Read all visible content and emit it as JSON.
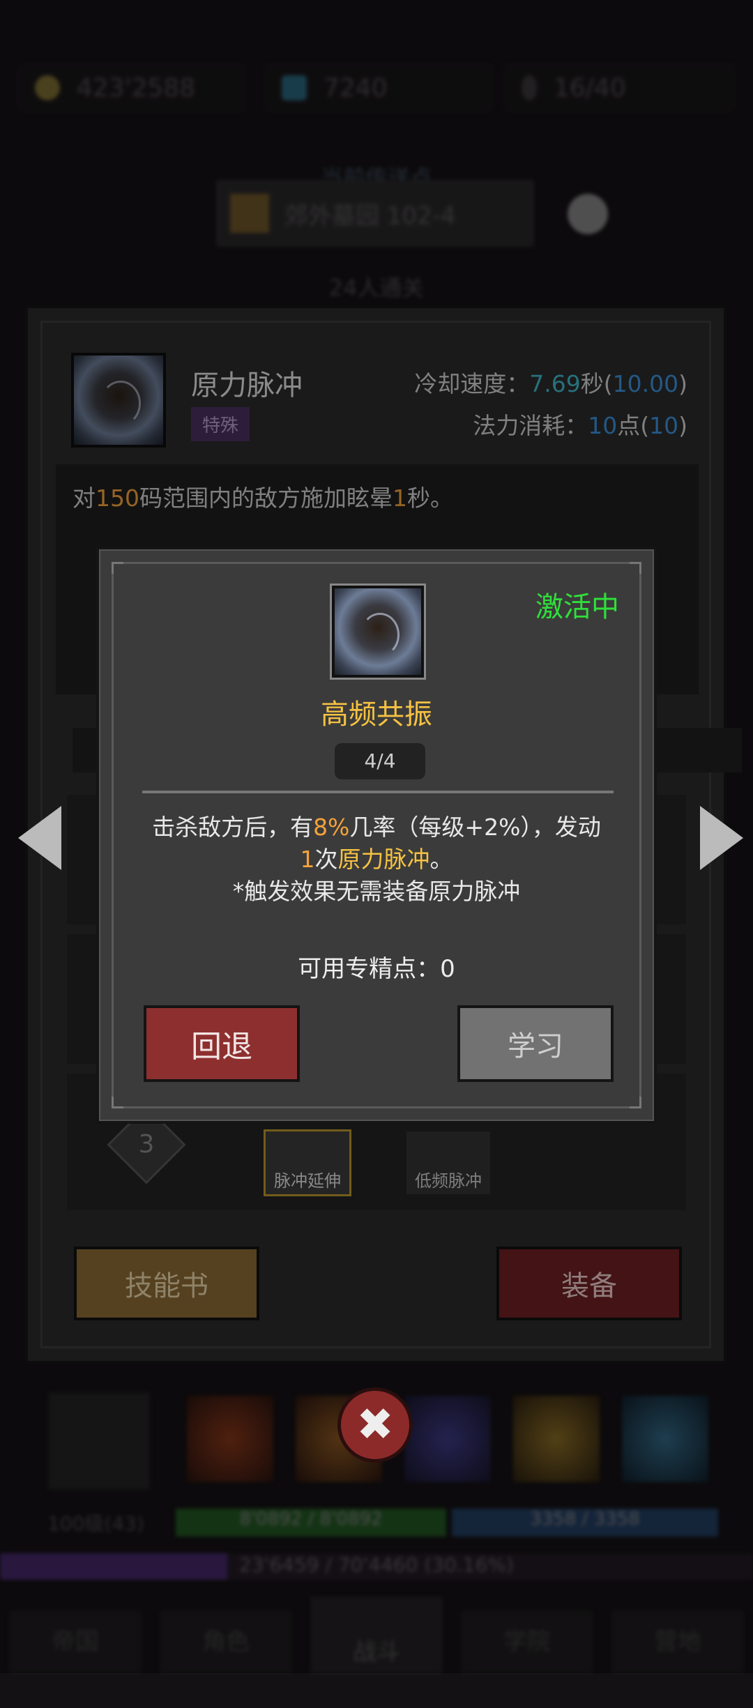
{
  "top_bar": {
    "gold": "423'2588",
    "gems": "7240",
    "keys": "16/40"
  },
  "teleport": {
    "label": "当前传送点",
    "location": "郊外墓园 102-4",
    "clear_text": "24人通关"
  },
  "skill": {
    "name": "原力脉冲",
    "tag": "特殊",
    "cooldown_label": "冷却速度：",
    "cooldown_value": "7.69",
    "cooldown_unit": "秒",
    "cooldown_base": "10.00",
    "mana_label": "法力消耗：",
    "mana_value": "10",
    "mana_unit": "点",
    "mana_base": "10",
    "desc_part1": "对",
    "desc_range": "150",
    "desc_part2": "码范围内的敌方施加眩晕",
    "desc_duration": "1",
    "desc_part3": "秒。"
  },
  "tree": {
    "tier_number": "3",
    "node1_label": "脉冲延伸",
    "node2_label": "低频脉冲"
  },
  "panel_buttons": {
    "skillbook": "技能书",
    "equip": "装备"
  },
  "popup": {
    "status": "激活中",
    "title": "高频共振",
    "level": "4/4",
    "line1_a": "击杀敌方后，有",
    "line1_pct": "8%",
    "line1_b": "几率（每级+2%），发动",
    "line2_count": "1",
    "line2_a": "次",
    "line2_skill": "原力脉冲",
    "line2_b": "。",
    "line3": "*触发效果无需装备原力脉冲",
    "points": "可用专精点：0",
    "back_button": "回退",
    "learn_button": "学习"
  },
  "bottom": {
    "level_text": "100级(43)",
    "hp_text": "8'0892 / 8'0892",
    "mp_text": "3358 / 3358",
    "exp_text": "23'6459 / 70'4460 (30.16%)",
    "exp_fraction": 0.3016,
    "nav": [
      "帝国",
      "角色",
      "战斗",
      "学院",
      "营地"
    ]
  },
  "colors": {
    "green_status": "#2fe03a",
    "gold_title": "#f5c242",
    "orange_hl": "#f3a23a",
    "back_btn": "#8e2f2f",
    "equip_btn": "#6d1f22",
    "skillbook_btn": "#8a6a35"
  }
}
